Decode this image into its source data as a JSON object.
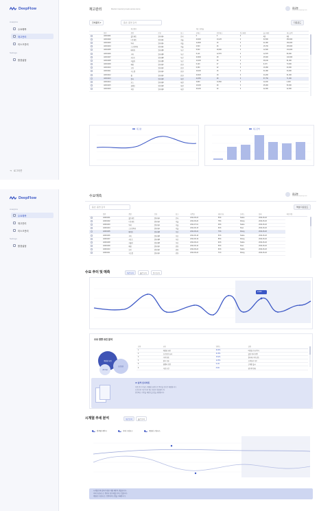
{
  "brand": {
    "name": "DeepFlow"
  },
  "top": {
    "sidebar": {
      "section1": "Analytics",
      "items": [
        {
          "label": "수요예측"
        },
        {
          "label": "재고관리"
        },
        {
          "label": "리스크관리"
        }
      ],
      "section2": "Settings",
      "items2": [
        {
          "label": "환경설정"
        }
      ],
      "bottom": "로그아웃"
    },
    "header": {
      "title": "재고관리",
      "subtitle": "Monitor inventory levels across items",
      "user_name": "홍길동",
      "user_role": "admin@company.com"
    },
    "toolbar": {
      "filter": "전체품목 ▾",
      "search_placeholder": "품번, 품명 검색",
      "export": "다운로드"
    },
    "table": {
      "group_headers": [
        "",
        "",
        "재고정보",
        "",
        "",
        "",
        "재고 회전율",
        "",
        ""
      ],
      "columns": [
        "",
        "품번",
        "품명",
        "분류",
        "창고",
        "현재고",
        "안전재고",
        "입고예정",
        "출고예정",
        "재고금액"
      ],
      "rows": [
        [
          "A0001001",
          "볼트세트",
          "원자재A",
          "본사",
          "0",
          "0",
          "0",
          "0원",
          "0원"
        ],
        [
          "A0001002",
          "너트세트",
          "원자재A",
          "서울",
          "40,000",
          "13,125",
          "0",
          "34,500",
          "250,000"
        ],
        [
          "A0001003",
          "와셔",
          "원자재A",
          "서울",
          "12,800",
          "16",
          "0",
          "21,900",
          "160,000"
        ],
        [
          "A0001004",
          "스프링와셔",
          "원자재A",
          "서울",
          "2,540",
          "26",
          "0",
          "15,700",
          "165,000"
        ],
        [
          "A0001005",
          "베어링",
          "원자재B",
          "부산",
          "5,540",
          "18,300",
          "0",
          "12,600",
          "134,000"
        ],
        [
          "A0001006",
          "기어",
          "원자재B",
          "부산",
          "8,110",
          "12,570",
          "0",
          "12,870",
          "80,000"
        ],
        [
          "A0001007",
          "샤프트",
          "원자재B",
          "부산",
          "23,800",
          "28",
          "0",
          "25,600",
          "140,000"
        ],
        [
          "A0001008",
          "커플링",
          "원자재B",
          "부산",
          "10,200",
          "50",
          "0",
          "38,190",
          "81,000"
        ],
        [
          "A0001009",
          "패킹",
          "원자재C",
          "인천",
          "6,120",
          "47",
          "0",
          "9,170",
          "70,000"
        ],
        [
          "A0001010",
          "오링",
          "원자재C",
          "인천",
          "6,300",
          "22",
          "0",
          "16,990",
          "40,000"
        ],
        [
          "A0001011",
          "가스켓",
          "원자재C",
          "인천",
          "19,200",
          "16",
          "0",
          "31,990",
          "33,000"
        ],
        [
          "A0001012",
          "씰",
          "원자재C",
          "인천",
          "20,620",
          "18",
          "0",
          "44,200",
          "91,000"
        ],
        [
          "A0001013",
          "필터",
          "원자재D",
          "대전",
          "42,050",
          "28",
          "0",
          "57,750",
          "71,000"
        ],
        [
          "A0001014",
          "호스",
          "원자재D",
          "대전",
          "3,800",
          "14,500",
          "0",
          "11,300",
          "4,000"
        ],
        [
          "A0001015",
          "클램프",
          "원자재D",
          "대전",
          "19,200",
          "28",
          "0",
          "45,000",
          "50,000"
        ],
        [
          "A0001016",
          "피팅",
          "원자재D",
          "대전",
          "26,200",
          "20",
          "0",
          "42,000",
          "42,000"
        ]
      ]
    },
    "chart_left": {
      "legend": "재고량"
    },
    "chart_right": {
      "legend": "재고금액"
    }
  },
  "bottom": {
    "sidebar": {
      "section1": "Analytics",
      "items": [
        {
          "label": "수요예측"
        },
        {
          "label": "재고관리"
        },
        {
          "label": "리스크관리"
        }
      ],
      "section2": "Settings",
      "items2": [
        {
          "label": "환경설정"
        }
      ]
    },
    "header": {
      "title": "수요예측",
      "user_name": "홍길동",
      "user_role": "admin@company.com"
    },
    "toolbar": {
      "search_placeholder": "품번, 품명 검색",
      "export": "엑셀 다운로드"
    },
    "table": {
      "columns": [
        "",
        "품번",
        "품명",
        "분류",
        "창고",
        "기준일",
        "예측수요",
        "신뢰도",
        "상태",
        "최종수정"
      ],
      "rows": [
        [
          "A0001001",
          "볼트세트",
          "원자재A",
          "본사",
          "2024-06-24",
          "53%",
          "Stable",
          "2024-06-20"
        ],
        [
          "A0001002",
          "너트세트",
          "원자재A",
          "서울",
          "2024-06-20",
          "78%",
          "Rising",
          "2024-06-20"
        ],
        [
          "A0001003",
          "와셔",
          "원자재A",
          "서울",
          "2024-07-01",
          "39%",
          "Stable",
          "2024-06-20"
        ],
        [
          "A0001004",
          "스프링와셔",
          "원자재A",
          "서울",
          "2024-06-15",
          "52%",
          "Slow",
          "2024-06-20"
        ],
        [
          "A0001005",
          "베어링",
          "원자재B",
          "부산",
          "2024-06-22",
          "73%",
          "Rising",
          "2024-06-20"
        ],
        [
          "A0001006",
          "기어",
          "원자재B",
          "부산",
          "2024-06-18",
          "54%",
          "Stable",
          "2024-06-20"
        ],
        [
          "A0001007",
          "샤프트",
          "원자재B",
          "부산",
          "2024-06-19",
          "86%",
          "Rising",
          "2024-06-20"
        ],
        [
          "A0001008",
          "커플링",
          "원자재B",
          "부산",
          "2024-06-21",
          "62%",
          "Stable",
          "2024-06-20"
        ],
        [
          "A0001009",
          "패킹",
          "원자재C",
          "인천",
          "2024-06-10",
          "50%",
          "Slow",
          "2024-06-20"
        ],
        [
          "A0001010",
          "오링",
          "원자재C",
          "인천",
          "2024-06-24",
          "64%",
          "Stable",
          "2024-06-20"
        ],
        [
          "A0001011",
          "가스켓",
          "원자재C",
          "인천",
          "2024-06-22",
          "71%",
          "Rising",
          "2024-06-20"
        ]
      ]
    },
    "trend": {
      "title": "수요 추이 및 예측",
      "pills": [
        "주간 보기",
        "월간 보기",
        "분기 보기"
      ],
      "badge": "2,940"
    },
    "factor": {
      "title": "수요 영향 요인 분석",
      "bubbles": [
        "계절성 요인",
        "프로모션",
        "경기지표"
      ],
      "columns": [
        "순위",
        "요인",
        "영향도",
        "설명"
      ],
      "rows": [
        [
          "1",
          "계절성 요인",
          "32.4%",
          "여름철 수요 증가"
        ],
        [
          "2",
          "프로모션 효과",
          "21.8%",
          "할인 행사 영향"
        ],
        [
          "3",
          "가격 변동",
          "15.2%",
          "원자재 가격 상승"
        ],
        [
          "4",
          "경기 지표",
          "12.6%",
          "소비심리 지수"
        ],
        [
          "5",
          "경쟁사 동향",
          "9.1%",
          "신제품 출시"
        ],
        [
          "6",
          "기상 조건",
          "8.9%",
          "강수량 변화"
        ]
      ]
    },
    "insight": {
      "title": "AI 분석 인사이트",
      "body": [
        "다음 분기 수요는 계절성 요인으로 증가할 것으로 예상됩니다.",
        "프로모션 기간 동안 재고 확보가 필요합니다.",
        "안전재고 수준을 재검토할 것을 권장합니다."
      ]
    },
    "seasonal": {
      "title": "시계열 추세 분석",
      "pills": [
        "주간 분석",
        "월간 분석"
      ],
      "toggles": [
        "원계열 데이터",
        "추세 구성요소",
        "계절성 구성요소"
      ],
      "note": [
        "시계열 분해 결과 뚜렷한 계절 패턴이 관찰됩니다.",
        "추세 구성요소는 완만한 상승세를 보이고 있습니다.",
        "계절성 구성요소는 연말에 최고점을 기록합니다."
      ]
    }
  }
}
